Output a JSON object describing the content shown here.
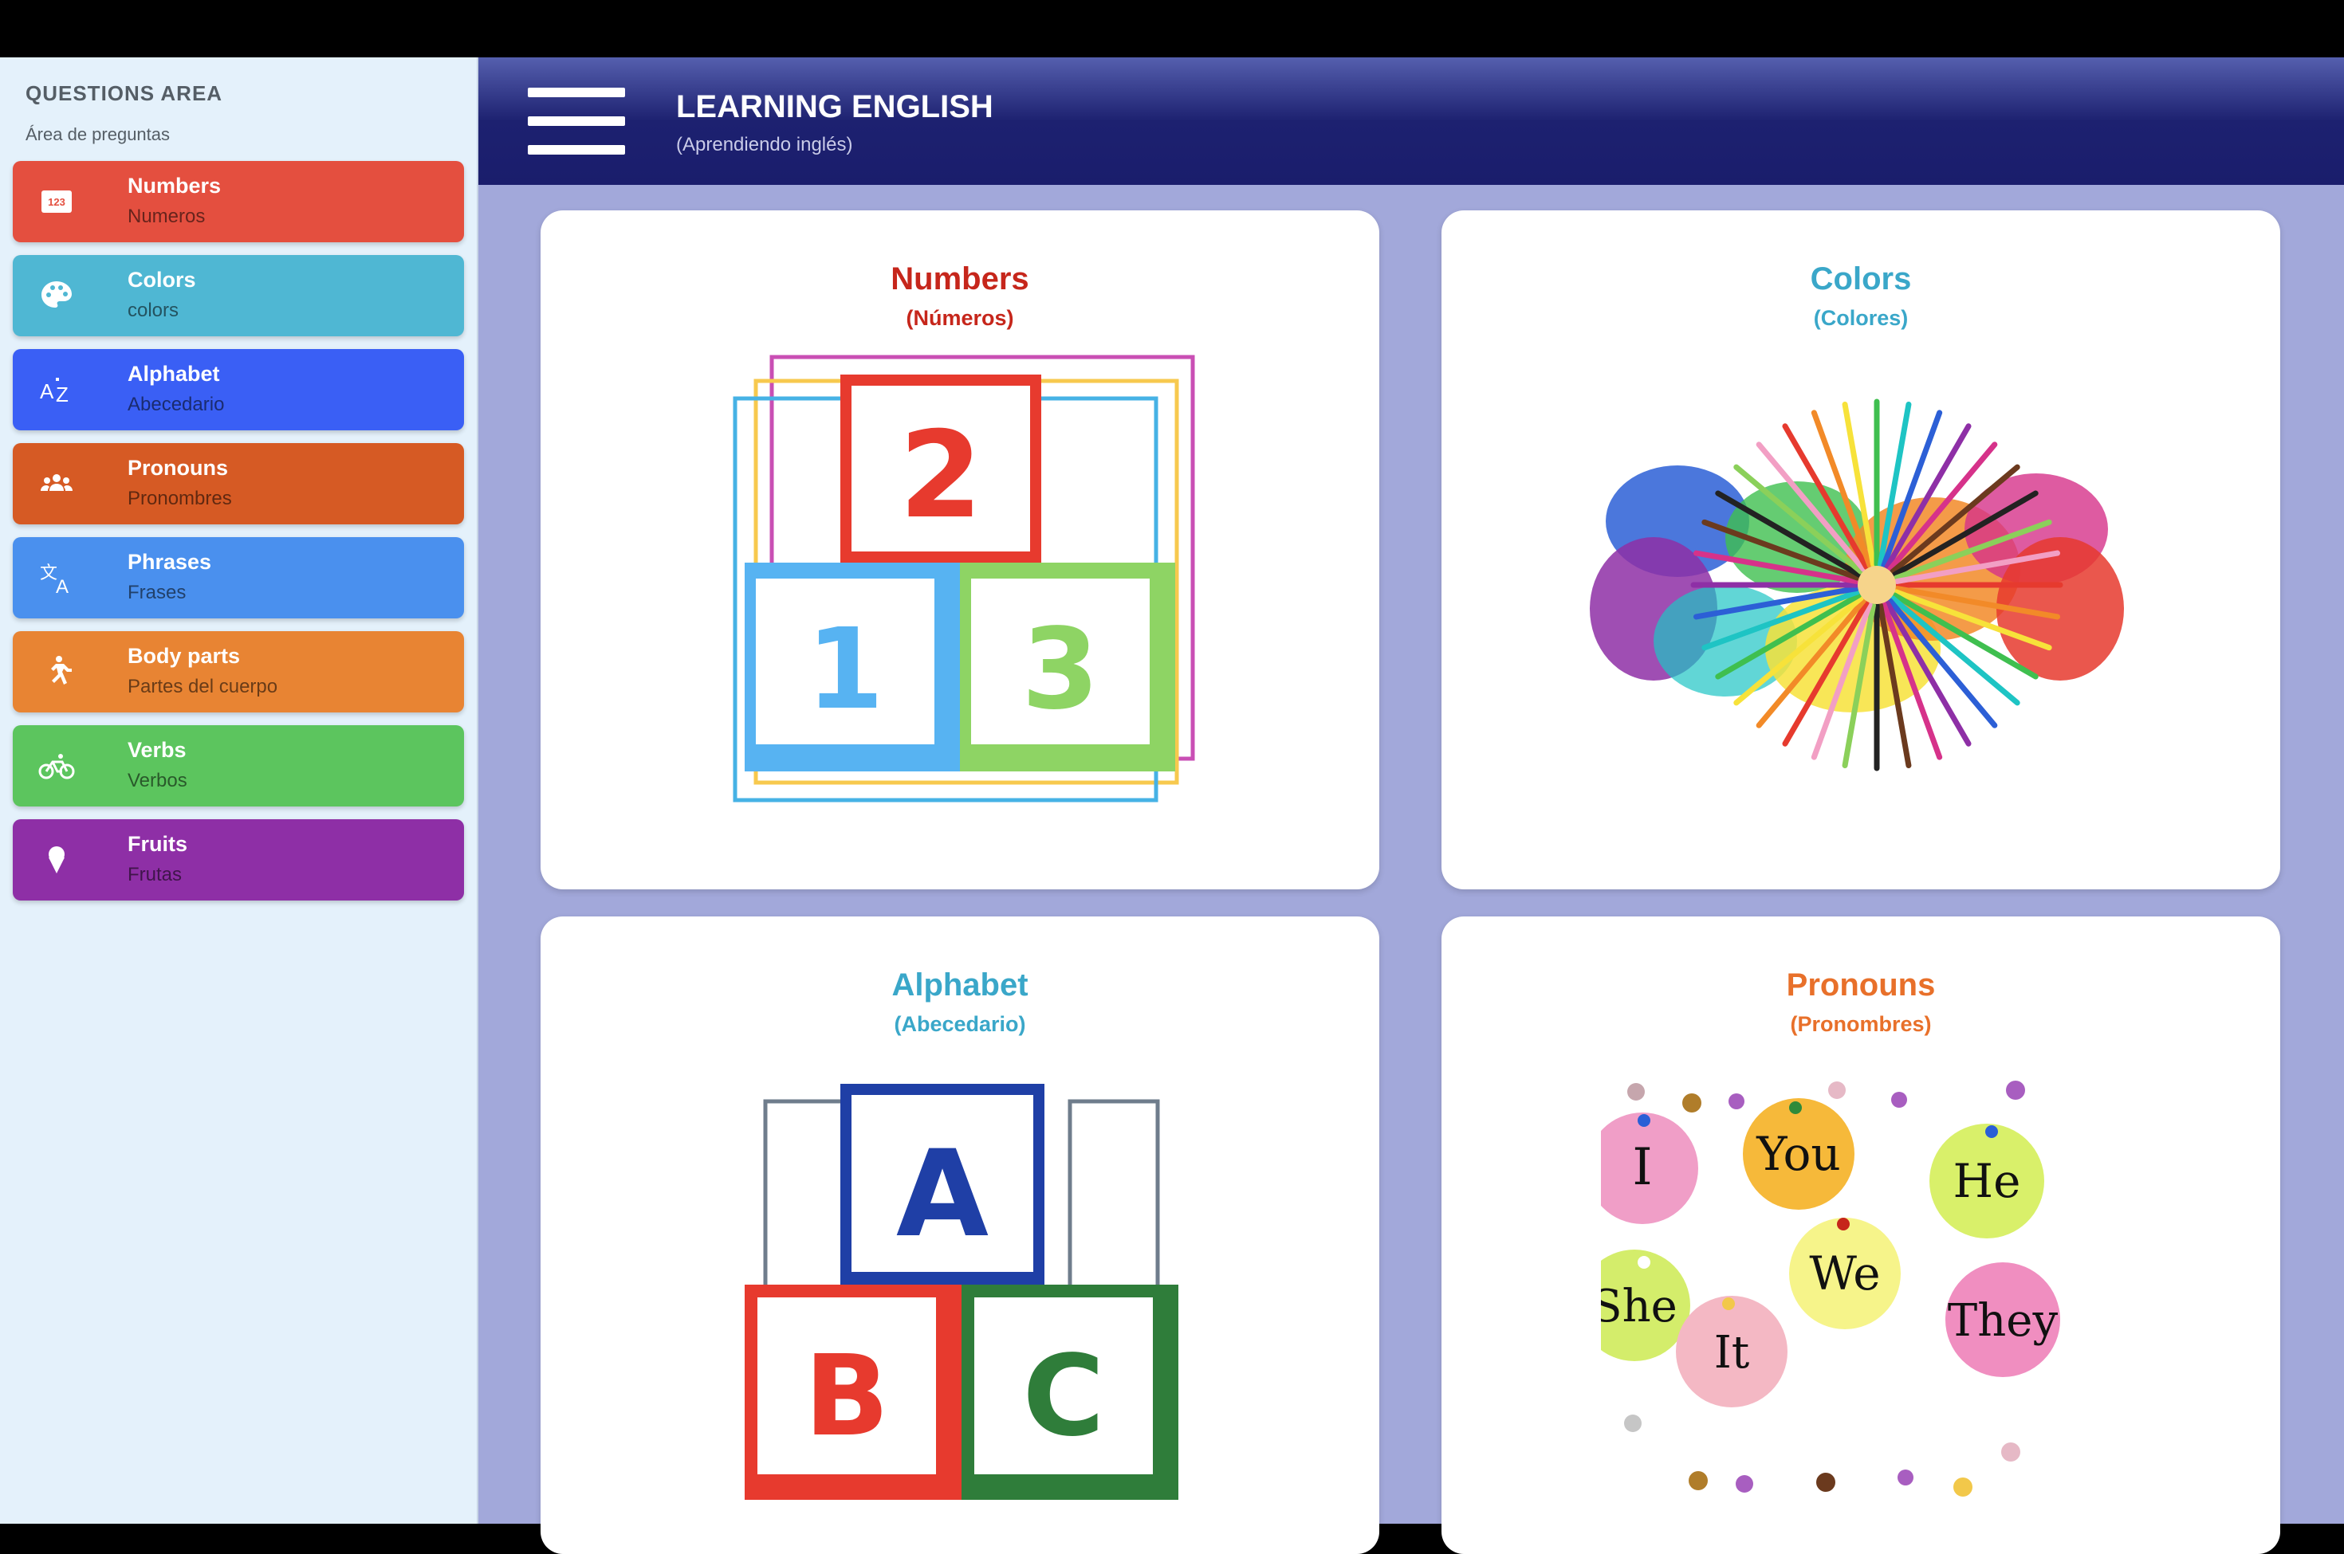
{
  "sidebar": {
    "title": "QUESTIONS AREA",
    "subtitle": "Área de preguntas",
    "items": [
      {
        "label": "Numbers",
        "label_es": "Numeros",
        "icon": "numbers-123-icon",
        "color": "#e44f3f"
      },
      {
        "label": "Colors",
        "label_es": "colors",
        "icon": "palette-icon",
        "color": "#4fb7d3"
      },
      {
        "label": "Alphabet",
        "label_es": "Abecedario",
        "icon": "sort-alpha-icon",
        "color": "#3a5ff5"
      },
      {
        "label": "Pronouns",
        "label_es": "Pronombres",
        "icon": "group-icon",
        "color": "#d65a24"
      },
      {
        "label": "Phrases",
        "label_es": "Frases",
        "icon": "translate-icon",
        "color": "#4a90ee"
      },
      {
        "label": "Body parts",
        "label_es": "Partes del cuerpo",
        "icon": "running-person-icon",
        "color": "#e88433"
      },
      {
        "label": "Verbs",
        "label_es": "Verbos",
        "icon": "bicycle-icon",
        "color": "#5cc55e"
      },
      {
        "label": "Fruits",
        "label_es": "Frutas",
        "icon": "ice-cream-icon",
        "color": "#8e2fa6"
      }
    ]
  },
  "header": {
    "title": "LEARNING ENGLISH",
    "subtitle": "(Aprendiendo inglés)",
    "menu_icon": "hamburger-menu-icon",
    "background": "#1a1d6c"
  },
  "cards": [
    {
      "title": "Numbers",
      "subtitle": "(Números)",
      "color": "#c6261b",
      "image": "number-blocks-123"
    },
    {
      "title": "Colors",
      "subtitle": "(Colores)",
      "color": "#3aa7c9",
      "image": "colored-pencils-splash"
    },
    {
      "title": "Alphabet",
      "subtitle": "(Abecedario)",
      "color": "#3aa7c9",
      "image": "alphabet-blocks-abc"
    },
    {
      "title": "Pronouns",
      "subtitle": "(Pronombres)",
      "color": "#e8702a",
      "image": "pronoun-bubbles",
      "words": [
        "I",
        "You",
        "He",
        "She",
        "We",
        "It",
        "They"
      ]
    }
  ],
  "blocks": {
    "numbers": [
      "2",
      "1",
      "3"
    ],
    "letters": [
      "A",
      "B",
      "C"
    ]
  }
}
